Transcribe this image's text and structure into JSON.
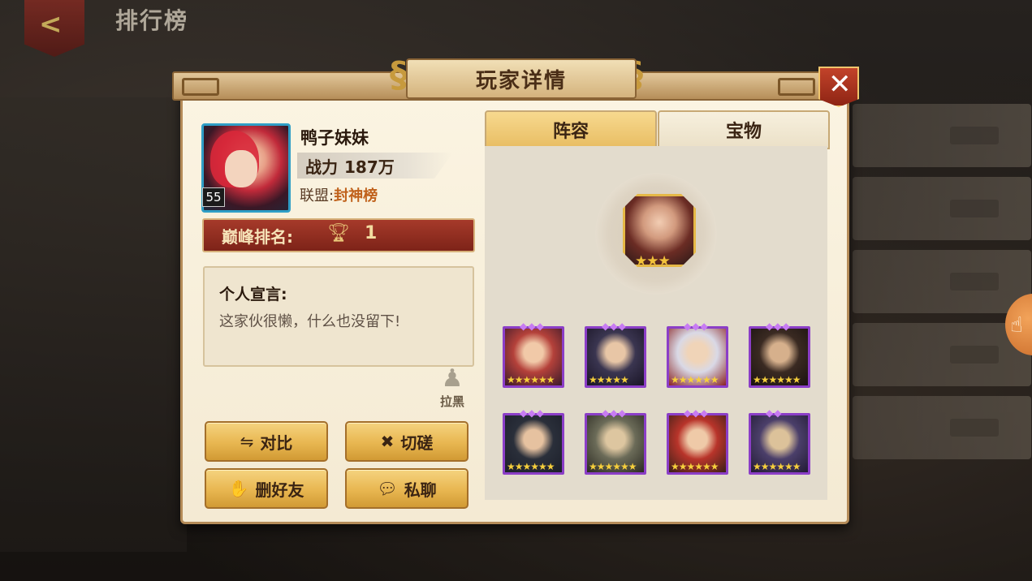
{
  "topbar": {
    "title": "排行榜",
    "back_icon": "back-arrow-icon"
  },
  "dialog": {
    "title": "玩家详情",
    "close_icon": "close-icon",
    "player": {
      "name": "鸭子妹妹",
      "level": "55",
      "power_label": "战力",
      "power_value": "187万",
      "alliance_label": "联盟:",
      "alliance_value": "封神榜"
    },
    "rank": {
      "label": "巅峰排名:",
      "value": "1",
      "icon": "trophy-icon"
    },
    "declaration": {
      "title": "个人宣言:",
      "text": "这家伙很懒，什么也没留下!"
    },
    "block": {
      "label": "拉黑",
      "icon": "blacklist-icon"
    },
    "buttons": {
      "compare": {
        "label": "对比",
        "icon": "compare-icon"
      },
      "spar": {
        "label": "切磋",
        "icon": "crossed-swords-icon"
      },
      "unfriend": {
        "label": "删好友",
        "icon": "handshake-icon"
      },
      "chat": {
        "label": "私聊",
        "icon": "chat-bubble-icon"
      }
    },
    "tabs": [
      {
        "label": "阵容",
        "active": true
      },
      {
        "label": "宝物",
        "active": false
      }
    ],
    "lineup": {
      "leader": {
        "stars": 3
      },
      "heroes": [
        {
          "stars": 6,
          "gems": 3
        },
        {
          "stars": 5,
          "gems": 3
        },
        {
          "stars": 6,
          "gems": 3
        },
        {
          "stars": 6,
          "gems": 3
        },
        {
          "stars": 6,
          "gems": 3
        },
        {
          "stars": 6,
          "gems": 3
        },
        {
          "stars": 6,
          "gems": 3
        },
        {
          "stars": 6,
          "gems": 2
        }
      ]
    }
  },
  "colors": {
    "accent_gold": "#e8b650",
    "rank_red": "#a63a2a",
    "hero_border": "#8b3ec7",
    "alliance_orange": "#c0611b"
  }
}
